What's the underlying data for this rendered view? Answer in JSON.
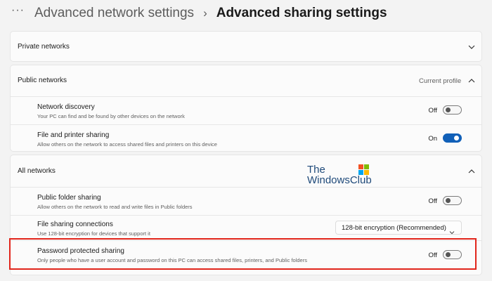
{
  "breadcrumb": {
    "more": "···",
    "parent": "Advanced network settings",
    "separator": "›",
    "current": "Advanced sharing settings"
  },
  "private_networks": {
    "title": "Private networks"
  },
  "public_networks": {
    "title": "Public networks",
    "profile_label": "Current profile",
    "items": [
      {
        "title": "Network discovery",
        "description": "Your PC can find and be found by other devices on the network",
        "state": "Off",
        "on": false
      },
      {
        "title": "File and printer sharing",
        "description": "Allow others on the network to access shared files and printers on this device",
        "state": "On",
        "on": true
      }
    ]
  },
  "all_networks": {
    "title": "All networks",
    "items": [
      {
        "title": "Public folder sharing",
        "description": "Allow others on the network to read and write files in Public folders",
        "state": "Off",
        "on": false
      },
      {
        "title": "File sharing connections",
        "description": "Use 128-bit encryption for devices that support it",
        "select_value": "128-bit encryption (Recommended)"
      },
      {
        "title": "Password protected sharing",
        "description": "Only people who have a user account and password on this PC can access shared files, printers, and Public folders",
        "state": "Off",
        "on": false
      }
    ]
  },
  "watermark": {
    "line1": "The",
    "line2": "WindowsClub"
  },
  "colors": {
    "accent": "#1160b8",
    "highlight_box": "#e1251b",
    "background": "#f3f3f3"
  }
}
